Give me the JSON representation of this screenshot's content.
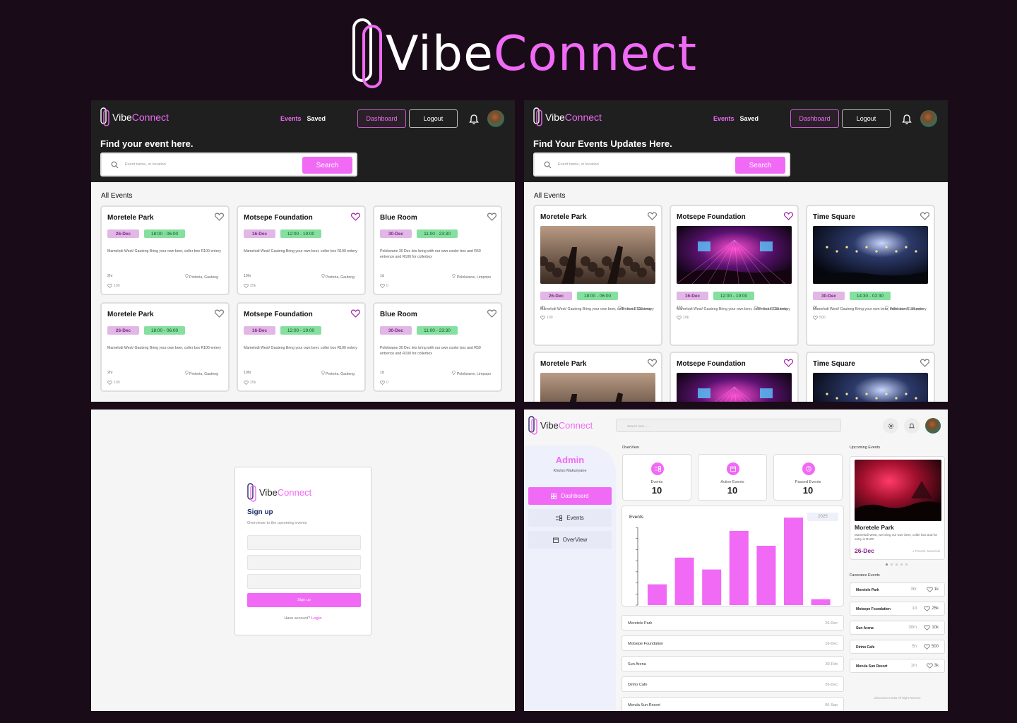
{
  "hero": {
    "brand_part1": "Vibe",
    "brand_part2": "Connect"
  },
  "brand": {
    "part1": "Vibe",
    "part2": "Connect",
    "accent": "#f06af5"
  },
  "nav": {
    "events": "Events",
    "saved": "Saved",
    "dashboard": "Dashboard",
    "logout": "Logout"
  },
  "search": {
    "placeholder": "Event name, or location",
    "button": "Search"
  },
  "screen1": {
    "heading": "Find your event here.",
    "section": "All Events",
    "cards": [
      {
        "title": "Moretele Park",
        "date": "26-Dec",
        "time": "18:00 - 06:00",
        "desc": "Mamelodi West/ Gauteng Bring your own beer, coller box R100 entery",
        "ago": "2hr",
        "location": "Pretoria, Gauteng",
        "likes": "100",
        "saved": false
      },
      {
        "title": "Motsepe Foundation",
        "date": "16-Dec",
        "time": "12:00 - 19:00",
        "desc": "Mamelodi West/ Gauteng Bring your own beer, coller box R100 entery",
        "ago": "10hr",
        "location": "Pretoria, Gauteng",
        "likes": "25k",
        "saved": true
      },
      {
        "title": "Blue Room",
        "date": "30-Dec",
        "time": "11:00 - 23:30",
        "desc": "Polokwane 30 Dec lets bring with our own cooler box and R50 entrence and R100 for collerbox",
        "ago": "1d",
        "location": "Polokwane, Limpopo",
        "likes": "0",
        "saved": false
      },
      {
        "title": "Moretele Park",
        "date": "26-Dec",
        "time": "18:00 - 06:00",
        "desc": "Mamelodi West/ Gauteng Bring your own beer, coller box R100 entery",
        "ago": "2hr",
        "location": "Pretoria, Gauteng",
        "likes": "100",
        "saved": false
      },
      {
        "title": "Motsepe Foundation",
        "date": "16-Dec",
        "time": "12:00 - 19:00",
        "desc": "Mamelodi West/ Gauteng Bring your own beer, coller box R100 entery",
        "ago": "10hr",
        "location": "Pretoria, Gauteng",
        "likes": "25k",
        "saved": true
      },
      {
        "title": "Blue Room",
        "date": "30-Dec",
        "time": "11:00 - 23:30",
        "desc": "Polokwane 30 Dec lets bring with our own cooler box and R50 entrence and R100 for collerbox",
        "ago": "1d",
        "location": "Polokwane, Limpopo",
        "likes": "0",
        "saved": false
      }
    ]
  },
  "screen2": {
    "heading": "Find Your Events Updates Here.",
    "section": "All Events",
    "cards": [
      {
        "title": "Moretele Park",
        "date": "26-Dec",
        "time": "18:00 - 06:00",
        "desc": "Mamelodi West/ Gauteng Bring your own beer, coller box R100 entery",
        "ago": "2hr",
        "location": "Pretoria, Gauteng",
        "likes": "100",
        "saved": false
      },
      {
        "title": "Motsepe Foundation",
        "date": "16-Dec",
        "time": "12:00 - 19:00",
        "desc": "Mamelodi West/ Gauteng Bring your own beer, coller box R100 entery",
        "ago": "16h",
        "location": "Pretoria, Gauteng",
        "likes": "10k",
        "saved": true
      },
      {
        "title": "Time Square",
        "date": "30-Dec",
        "time": "14:30 - 02:30",
        "desc": "Mamelodi West/ Gauteng Bring your own beer, coller box R100 entery",
        "ago": "2d",
        "location": "Polokwane, Limpopo",
        "likes": "500",
        "saved": false
      },
      {
        "title": "Moretele Park",
        "saved": false
      },
      {
        "title": "Motsepe Foundation",
        "saved": true
      },
      {
        "title": "Time Square",
        "saved": false
      }
    ]
  },
  "signup": {
    "title": "Sign up",
    "subtitle": "Overviewe to the upcoming events",
    "button": "Sign up",
    "have_account": "Have account?",
    "login": "Login"
  },
  "dashboard": {
    "search_placeholder": "Search here .....",
    "role": "Admin",
    "user": "Khutso Makunyane",
    "menu": [
      "Dashboard",
      "Events",
      "OverView"
    ],
    "overview_label": "OverView",
    "stats": [
      {
        "label": "Events",
        "value": "10",
        "icon": "events-icon"
      },
      {
        "label": "Active Events",
        "value": "10",
        "icon": "calendar-icon"
      },
      {
        "label": "Passed Events",
        "value": "10",
        "icon": "clock-icon"
      }
    ],
    "chart_title": "Events",
    "year": "2025",
    "list": [
      {
        "name": "Moretele Park",
        "date": "26-Dec"
      },
      {
        "name": "Motsepe Foundation",
        "date": "16-Dec"
      },
      {
        "name": "Sun Arena",
        "date": "30-Feb"
      },
      {
        "name": "Dinho Cafe",
        "date": "26-Dec"
      },
      {
        "name": "Morula Sun Resort",
        "date": "06-Sep"
      }
    ],
    "upcoming_label": "Upcoming Events",
    "upcoming": {
      "name": "Moretele Park",
      "desc": "Mamelodi West, we bring our own beer, coller box and for entry is R100",
      "date": "26-Dec",
      "location": "Pretoria, Mamelodi"
    },
    "favorites_label": "Favorates Events",
    "favorites": [
      {
        "name": "Moretele Park",
        "time": "3hr",
        "likes": "1k"
      },
      {
        "name": "Motsepe Foundation",
        "time": "1d",
        "likes": "25k"
      },
      {
        "name": "Sun Arena",
        "time": "30m",
        "likes": "10k"
      },
      {
        "name": "Dinho Cafe",
        "time": "5h",
        "likes": "500"
      },
      {
        "name": "Morula Sun Resort",
        "time": "1m",
        "likes": "3k"
      }
    ],
    "footer": "vibeconnect 2025 All Right Reserve"
  },
  "chart_data": {
    "type": "bar",
    "title": "Events",
    "values": [
      14,
      32,
      24,
      50,
      40,
      59,
      4
    ],
    "ylim": [
      0,
      60
    ],
    "color": "#f06af5",
    "grid": false
  }
}
